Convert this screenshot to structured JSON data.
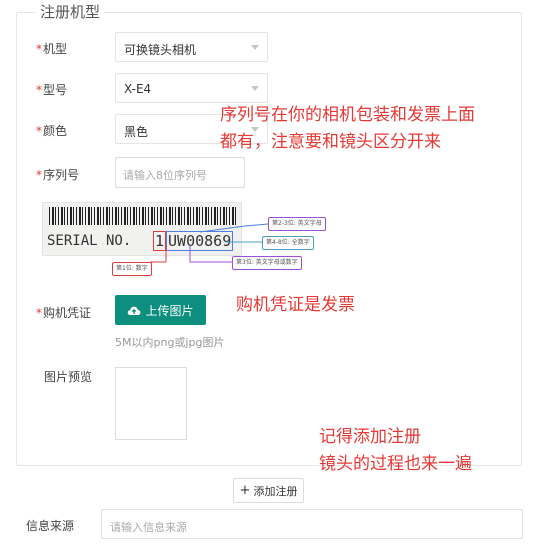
{
  "form": {
    "legend": "注册机型",
    "required_mark": "*",
    "fields": {
      "model_type": {
        "label": "机型",
        "value": "可换镜头相机"
      },
      "model": {
        "label": "型号",
        "value": "X-E4"
      },
      "color": {
        "label": "颜色",
        "value": "黑色"
      },
      "serial": {
        "label": "序列号",
        "placeholder": "请输入8位序列号"
      },
      "receipt": {
        "label": "购机凭证",
        "button": "上传图片",
        "hint": "5M以内png或jpg图片"
      },
      "preview": {
        "label": "图片预览"
      }
    },
    "serial_example": {
      "text_label": "SERIAL NO.",
      "digit": "1",
      "code": "UW00869",
      "callouts": [
        "第1位: 数字",
        "第2-3位: 英文字母",
        "第4-8位: 全数字",
        "第3位: 英文字母或数字"
      ]
    },
    "add_button": "添加注册"
  },
  "source": {
    "label": "信息来源",
    "placeholder": "请输入信息来源"
  },
  "annotations": {
    "serial_note_line1": "序列号在你的相机包装和发票上面",
    "serial_note_line2": "都有，注意要和镜头区分开来",
    "receipt_note": "购机凭证是发票",
    "lens_note_line1": "记得添加注册",
    "lens_note_line2": "镜头的过程也来一遍"
  },
  "colors": {
    "required": "#e53935",
    "annotation": "#e53935",
    "upload_button": "#0d8f7f",
    "callout_blue": "#4a7fe0",
    "callout_purple": "#9b4fd1",
    "callout_red": "#d9423e"
  },
  "icons": [
    "cloud-upload-icon",
    "plus-icon",
    "caret-down-icon"
  ]
}
